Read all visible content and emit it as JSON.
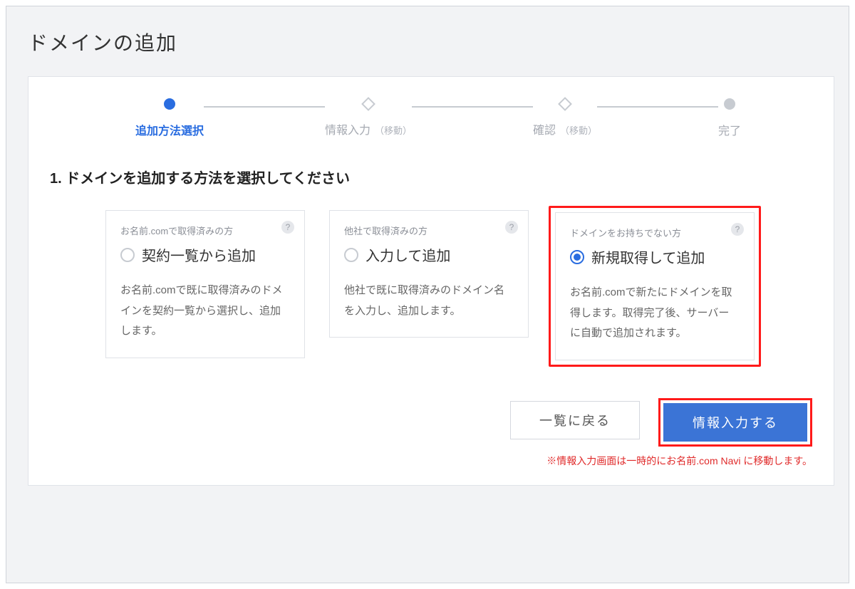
{
  "page_title": "ドメインの追加",
  "stepper": [
    {
      "label": "追加方法選択",
      "sublabel": "",
      "active": true,
      "shape": "dot"
    },
    {
      "label": "情報入力",
      "sublabel": "（移動）",
      "active": false,
      "shape": "diamond"
    },
    {
      "label": "確認",
      "sublabel": "（移動）",
      "active": false,
      "shape": "diamond"
    },
    {
      "label": "完了",
      "sublabel": "",
      "active": false,
      "shape": "dot"
    }
  ],
  "section_title": "1. ドメインを追加する方法を選択してください",
  "cards": [
    {
      "subtitle": "お名前.comで取得済みの方",
      "radio_label": "契約一覧から追加",
      "desc": "お名前.comで既に取得済みのドメインを契約一覧から選択し、追加します。",
      "selected": false,
      "highlighted": false
    },
    {
      "subtitle": "他社で取得済みの方",
      "radio_label": "入力して追加",
      "desc": "他社で既に取得済みのドメイン名を入力し、追加します。",
      "selected": false,
      "highlighted": false
    },
    {
      "subtitle": "ドメインをお持ちでない方",
      "radio_label": "新規取得して追加",
      "desc": "お名前.comで新たにドメインを取得します。取得完了後、サーバーに自動で追加されます。",
      "selected": true,
      "highlighted": true
    }
  ],
  "buttons": {
    "back": "一覧に戻る",
    "next": "情報入力する"
  },
  "note": "※情報入力画面は一時的にお名前.com Navi に移動します。"
}
